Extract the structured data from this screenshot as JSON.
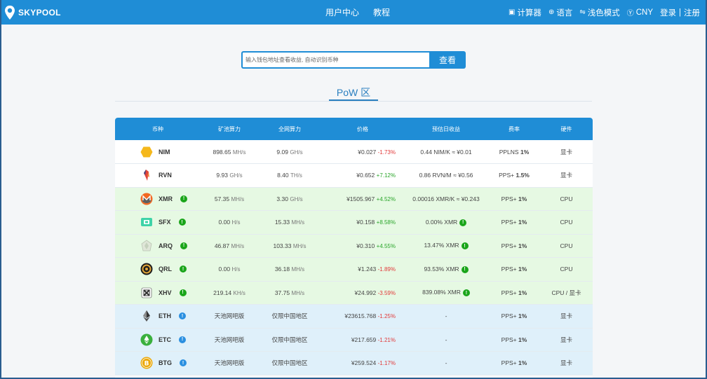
{
  "brand": {
    "name": "SKYPOOL"
  },
  "nav": {
    "center": [
      "用户中心",
      "教程"
    ],
    "calculator": "计算器",
    "language": "语言",
    "theme": "浅色模式",
    "currency": "CNY",
    "login": "登录",
    "separator": "|",
    "register": "注册"
  },
  "search": {
    "placeholder": "输入钱包地址查看收益, 自动识别币种",
    "button": "查看"
  },
  "section": {
    "title": "PoW 区"
  },
  "table": {
    "headers": [
      "币种",
      "矿池算力",
      "全网算力",
      "价格",
      "预估日收益",
      "费率",
      "硬件"
    ],
    "rows": [
      {
        "coin": "NIM",
        "icon": "nim-hexagon-icon",
        "color": "#f5b81c",
        "pool": "898.65",
        "pool_unit": "MH/s",
        "net": "9.09",
        "net_unit": "GH/s",
        "price": "¥0.027",
        "change": "-1.73%",
        "income": "0.44 NIM/K ≈ ¥0.01",
        "fee_pre": "PPLNS ",
        "fee": "1%",
        "hw": "显卡",
        "badge": "",
        "cls": "gpu"
      },
      {
        "coin": "RVN",
        "icon": "raven-icon",
        "color": "#e1453a",
        "pool": "9.93",
        "pool_unit": "GH/s",
        "net": "8.40",
        "net_unit": "TH/s",
        "price": "¥0.652",
        "change": "+7.12%",
        "income": "0.86 RVN/M ≈ ¥0.56",
        "fee_pre": "PPS+ ",
        "fee": "1.5%",
        "hw": "显卡",
        "badge": "",
        "cls": "gpu"
      },
      {
        "coin": "XMR",
        "icon": "monero-icon",
        "color": "#f26822",
        "pool": "57.35",
        "pool_unit": "MH/s",
        "net": "3.30",
        "net_unit": "GH/s",
        "price": "¥1505.967",
        "change": "+4.52%",
        "income": "0.00016 XMR/K ≈ ¥0.243",
        "fee_pre": "PPS+ ",
        "fee": "1%",
        "hw": "CPU",
        "badge": "green",
        "cls": "cpu"
      },
      {
        "coin": "SFX",
        "icon": "safex-icon",
        "color": "#3ed3a8",
        "pool": "0.00",
        "pool_unit": "H/s",
        "net": "15.33",
        "net_unit": "MH/s",
        "price": "¥0.158",
        "change": "+8.58%",
        "income": "0.00% XMR",
        "fee_pre": "PPS+ ",
        "fee": "1%",
        "hw": "CPU",
        "badge": "green",
        "cls": "cpu",
        "income_badge": true
      },
      {
        "coin": "ARQ",
        "icon": "arqma-icon",
        "color": "#c9d6c2",
        "pool": "46.87",
        "pool_unit": "MH/s",
        "net": "103.33",
        "net_unit": "MH/s",
        "price": "¥0.310",
        "change": "+4.55%",
        "income": "13.47% XMR",
        "fee_pre": "PPS+ ",
        "fee": "1%",
        "hw": "CPU",
        "badge": "green",
        "cls": "cpu",
        "income_badge": true
      },
      {
        "coin": "QRL",
        "icon": "qrl-icon",
        "color": "#1c1c1c",
        "pool": "0.00",
        "pool_unit": "H/s",
        "net": "36.18",
        "net_unit": "MH/s",
        "price": "¥1.243",
        "change": "-1.89%",
        "income": "93.53% XMR",
        "fee_pre": "PPS+ ",
        "fee": "1%",
        "hw": "CPU",
        "badge": "green",
        "cls": "cpu",
        "income_badge": true
      },
      {
        "coin": "XHV",
        "icon": "haven-icon",
        "color": "#ffffff",
        "pool": "219.14",
        "pool_unit": "KH/s",
        "net": "37.75",
        "net_unit": "MH/s",
        "price": "¥24.992",
        "change": "-3.59%",
        "income": "839.08% XMR",
        "fee_pre": "PPS+ ",
        "fee": "1%",
        "hw": "CPU / 显卡",
        "badge": "green",
        "cls": "cpu",
        "income_badge": true
      },
      {
        "coin": "ETH",
        "icon": "ethereum-icon",
        "color": "#dff0fa",
        "pool": "天池网吧版",
        "pool_unit": "",
        "net": "仅限中国地区",
        "net_unit": "",
        "price": "¥23615.768",
        "change": "-1.25%",
        "income": "-",
        "fee_pre": "PPS+ ",
        "fee": "1%",
        "hw": "显卡",
        "badge": "blue",
        "cls": "eth"
      },
      {
        "coin": "ETC",
        "icon": "ethereum-classic-icon",
        "color": "#3ab03e",
        "pool": "天池网吧版",
        "pool_unit": "",
        "net": "仅限中国地区",
        "net_unit": "",
        "price": "¥217.659",
        "change": "-1.21%",
        "income": "-",
        "fee_pre": "PPS+ ",
        "fee": "1%",
        "hw": "显卡",
        "badge": "blue",
        "cls": "eth"
      },
      {
        "coin": "BTG",
        "icon": "bitcoin-gold-icon",
        "color": "#eba809",
        "pool": "天池网吧版",
        "pool_unit": "",
        "net": "仅限中国地区",
        "net_unit": "",
        "price": "¥259.524",
        "change": "-1.17%",
        "income": "-",
        "fee_pre": "PPS+ ",
        "fee": "1%",
        "hw": "显卡",
        "badge": "blue",
        "cls": "eth"
      }
    ]
  }
}
